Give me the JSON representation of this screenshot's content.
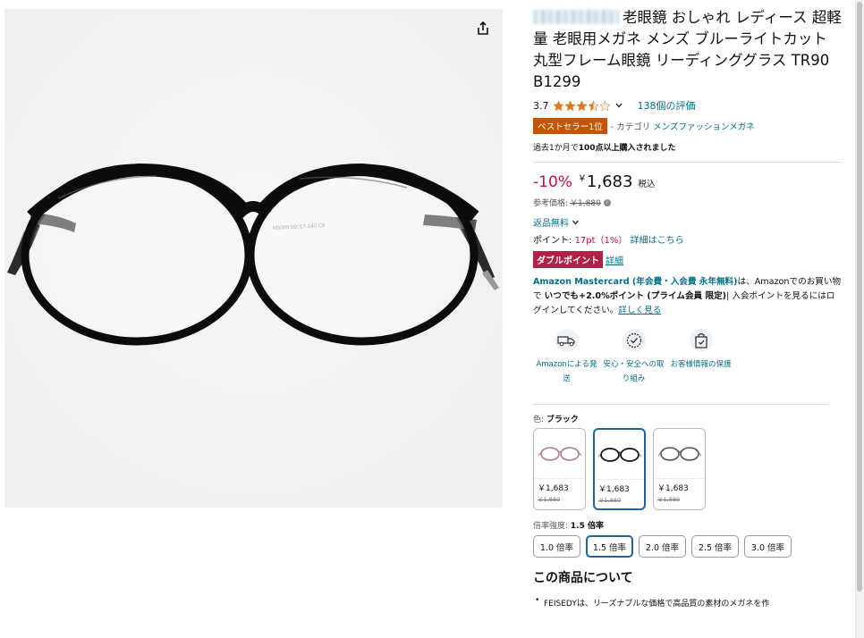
{
  "product": {
    "title": "老眼鏡 おしゃれ レディース 超軽量 老眼用メガネ メンズ ブルーライトカット 丸型フレーム眼鏡 リーディンググラス TR90 B1299",
    "frame_text": "M5009 50□17-140 C4"
  },
  "rating": {
    "value": "3.7",
    "stars_filled": 3.5,
    "count_text": "138個の評価"
  },
  "bestseller": {
    "badge": "ベストセラー1位",
    "category_prefix": "- カテゴリ",
    "category": "メンズファッションメガネ"
  },
  "bought_text": {
    "prefix": "過去1か月で",
    "bold": "100点以上購入されました"
  },
  "price": {
    "discount": "-10%",
    "currency": "￥",
    "amount": "1,683",
    "tax": "税込",
    "ref_label": "参考価格:",
    "ref_price": "￥1,880",
    "info": "i"
  },
  "returns": "返品無料",
  "points": {
    "label": "ポイント:",
    "value": "17pt（1%）",
    "details": "詳細はこちら"
  },
  "double_point": {
    "badge": "ダブルポイント",
    "link": "詳細"
  },
  "mastercard": {
    "title": "Amazon Mastercard (年会費・入会費 永年無料)",
    "t1": "は、Amazonでのお買い物で ",
    "bold1": "いつでも+2.0%ポイント (プライム会員 限定)",
    "t2": "| 入会ポイントを見るにはログインしてください。",
    "link": "詳しく見る"
  },
  "features": [
    {
      "icon": "truck-icon",
      "label": "Amazonによる発送"
    },
    {
      "icon": "shield-badge-icon",
      "label": "安心・安全への取り組み"
    },
    {
      "icon": "bag-check-icon",
      "label": "お客様情報の保護"
    }
  ],
  "color": {
    "label": "色: ",
    "value": "ブラック"
  },
  "swatches": [
    {
      "name": "pink",
      "price": "￥1,683",
      "old": "￥1,880",
      "frame_color": "#b07a8a"
    },
    {
      "name": "black",
      "price": "￥1,683",
      "old": "￥1,880",
      "frame_color": "#111111"
    },
    {
      "name": "gray",
      "price": "￥1,683",
      "old": "￥1,880",
      "frame_color": "#555555"
    }
  ],
  "magnification": {
    "label": "倍率強度: ",
    "value": "1.5 倍率",
    "options": [
      "1.0 倍率",
      "1.5 倍率",
      "2.0 倍率",
      "2.5 倍率",
      "3.0 倍率"
    ],
    "selected_index": 1
  },
  "about": {
    "title": "この商品について",
    "bullet1": "FEISEDYは、リーズナブルな価格で高品質の素材のメガネを作"
  },
  "colors": {
    "link": "#007185",
    "discount": "#cc0c39",
    "badge": "#c45500",
    "double_point": "#b12046",
    "selected_border": "#2162a1"
  }
}
